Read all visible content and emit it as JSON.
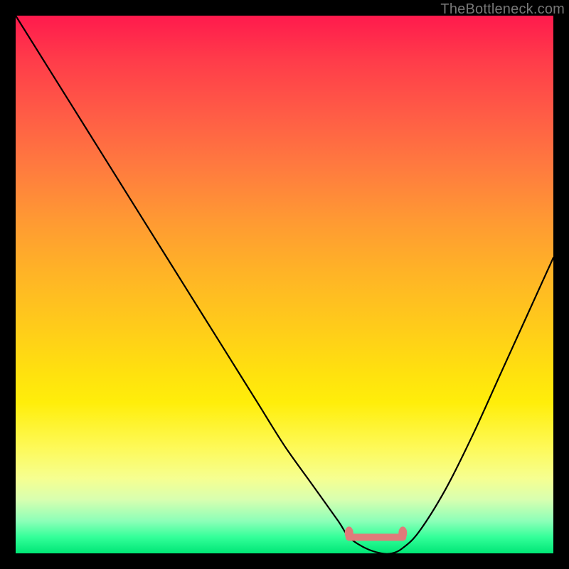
{
  "watermark": "TheBottleneck.com",
  "colors": {
    "background": "#000000",
    "curve": "#000000",
    "band": "#e07a7a",
    "gradient_top": "#ff1a4d",
    "gradient_bottom": "#00e676"
  },
  "chart_data": {
    "type": "line",
    "title": "",
    "xlabel": "",
    "ylabel": "",
    "xlim": [
      0,
      100
    ],
    "ylim": [
      0,
      100
    ],
    "grid": false,
    "legend": false,
    "x": [
      0,
      5,
      10,
      15,
      20,
      25,
      30,
      35,
      40,
      45,
      50,
      55,
      60,
      62,
      65,
      68,
      70,
      72,
      75,
      80,
      85,
      90,
      95,
      100
    ],
    "values": [
      100,
      92,
      84,
      76,
      68,
      60,
      52,
      44,
      36,
      28,
      20,
      13,
      6,
      3,
      1,
      0,
      0,
      1,
      4,
      12,
      22,
      33,
      44,
      55
    ],
    "optimal_band": {
      "x_start": 62,
      "x_end": 72,
      "y": 3
    },
    "annotations": []
  }
}
